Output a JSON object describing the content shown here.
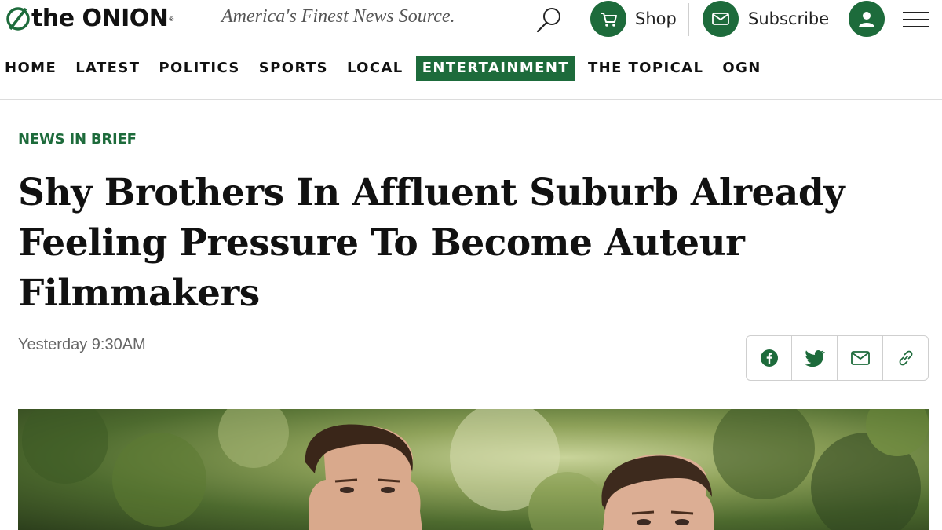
{
  "header": {
    "logo_text": "the ONION",
    "logo_mark": "®",
    "tagline": "America's Finest News Source.",
    "shop_label": "Shop",
    "subscribe_label": "Subscribe",
    "accent_color": "#1d6b3b",
    "icons": [
      "onion-logo-icon",
      "search-icon",
      "cart-icon",
      "mail-icon",
      "user-icon",
      "menu-icon"
    ]
  },
  "nav": {
    "items": [
      {
        "label": "HOME"
      },
      {
        "label": "LATEST"
      },
      {
        "label": "POLITICS"
      },
      {
        "label": "SPORTS"
      },
      {
        "label": "LOCAL"
      },
      {
        "label": "ENTERTAINMENT",
        "active": true
      },
      {
        "label": "THE TOPICAL"
      },
      {
        "label": "OGN"
      }
    ]
  },
  "article": {
    "section": "NEWS IN BRIEF",
    "headline": "Shy Brothers In Affluent Suburb Already Feeling Pressure To Become Auteur Filmmakers",
    "timestamp": "Yesterday 9:30AM",
    "share_icons": [
      "facebook-icon",
      "twitter-icon",
      "email-icon",
      "link-icon"
    ]
  }
}
